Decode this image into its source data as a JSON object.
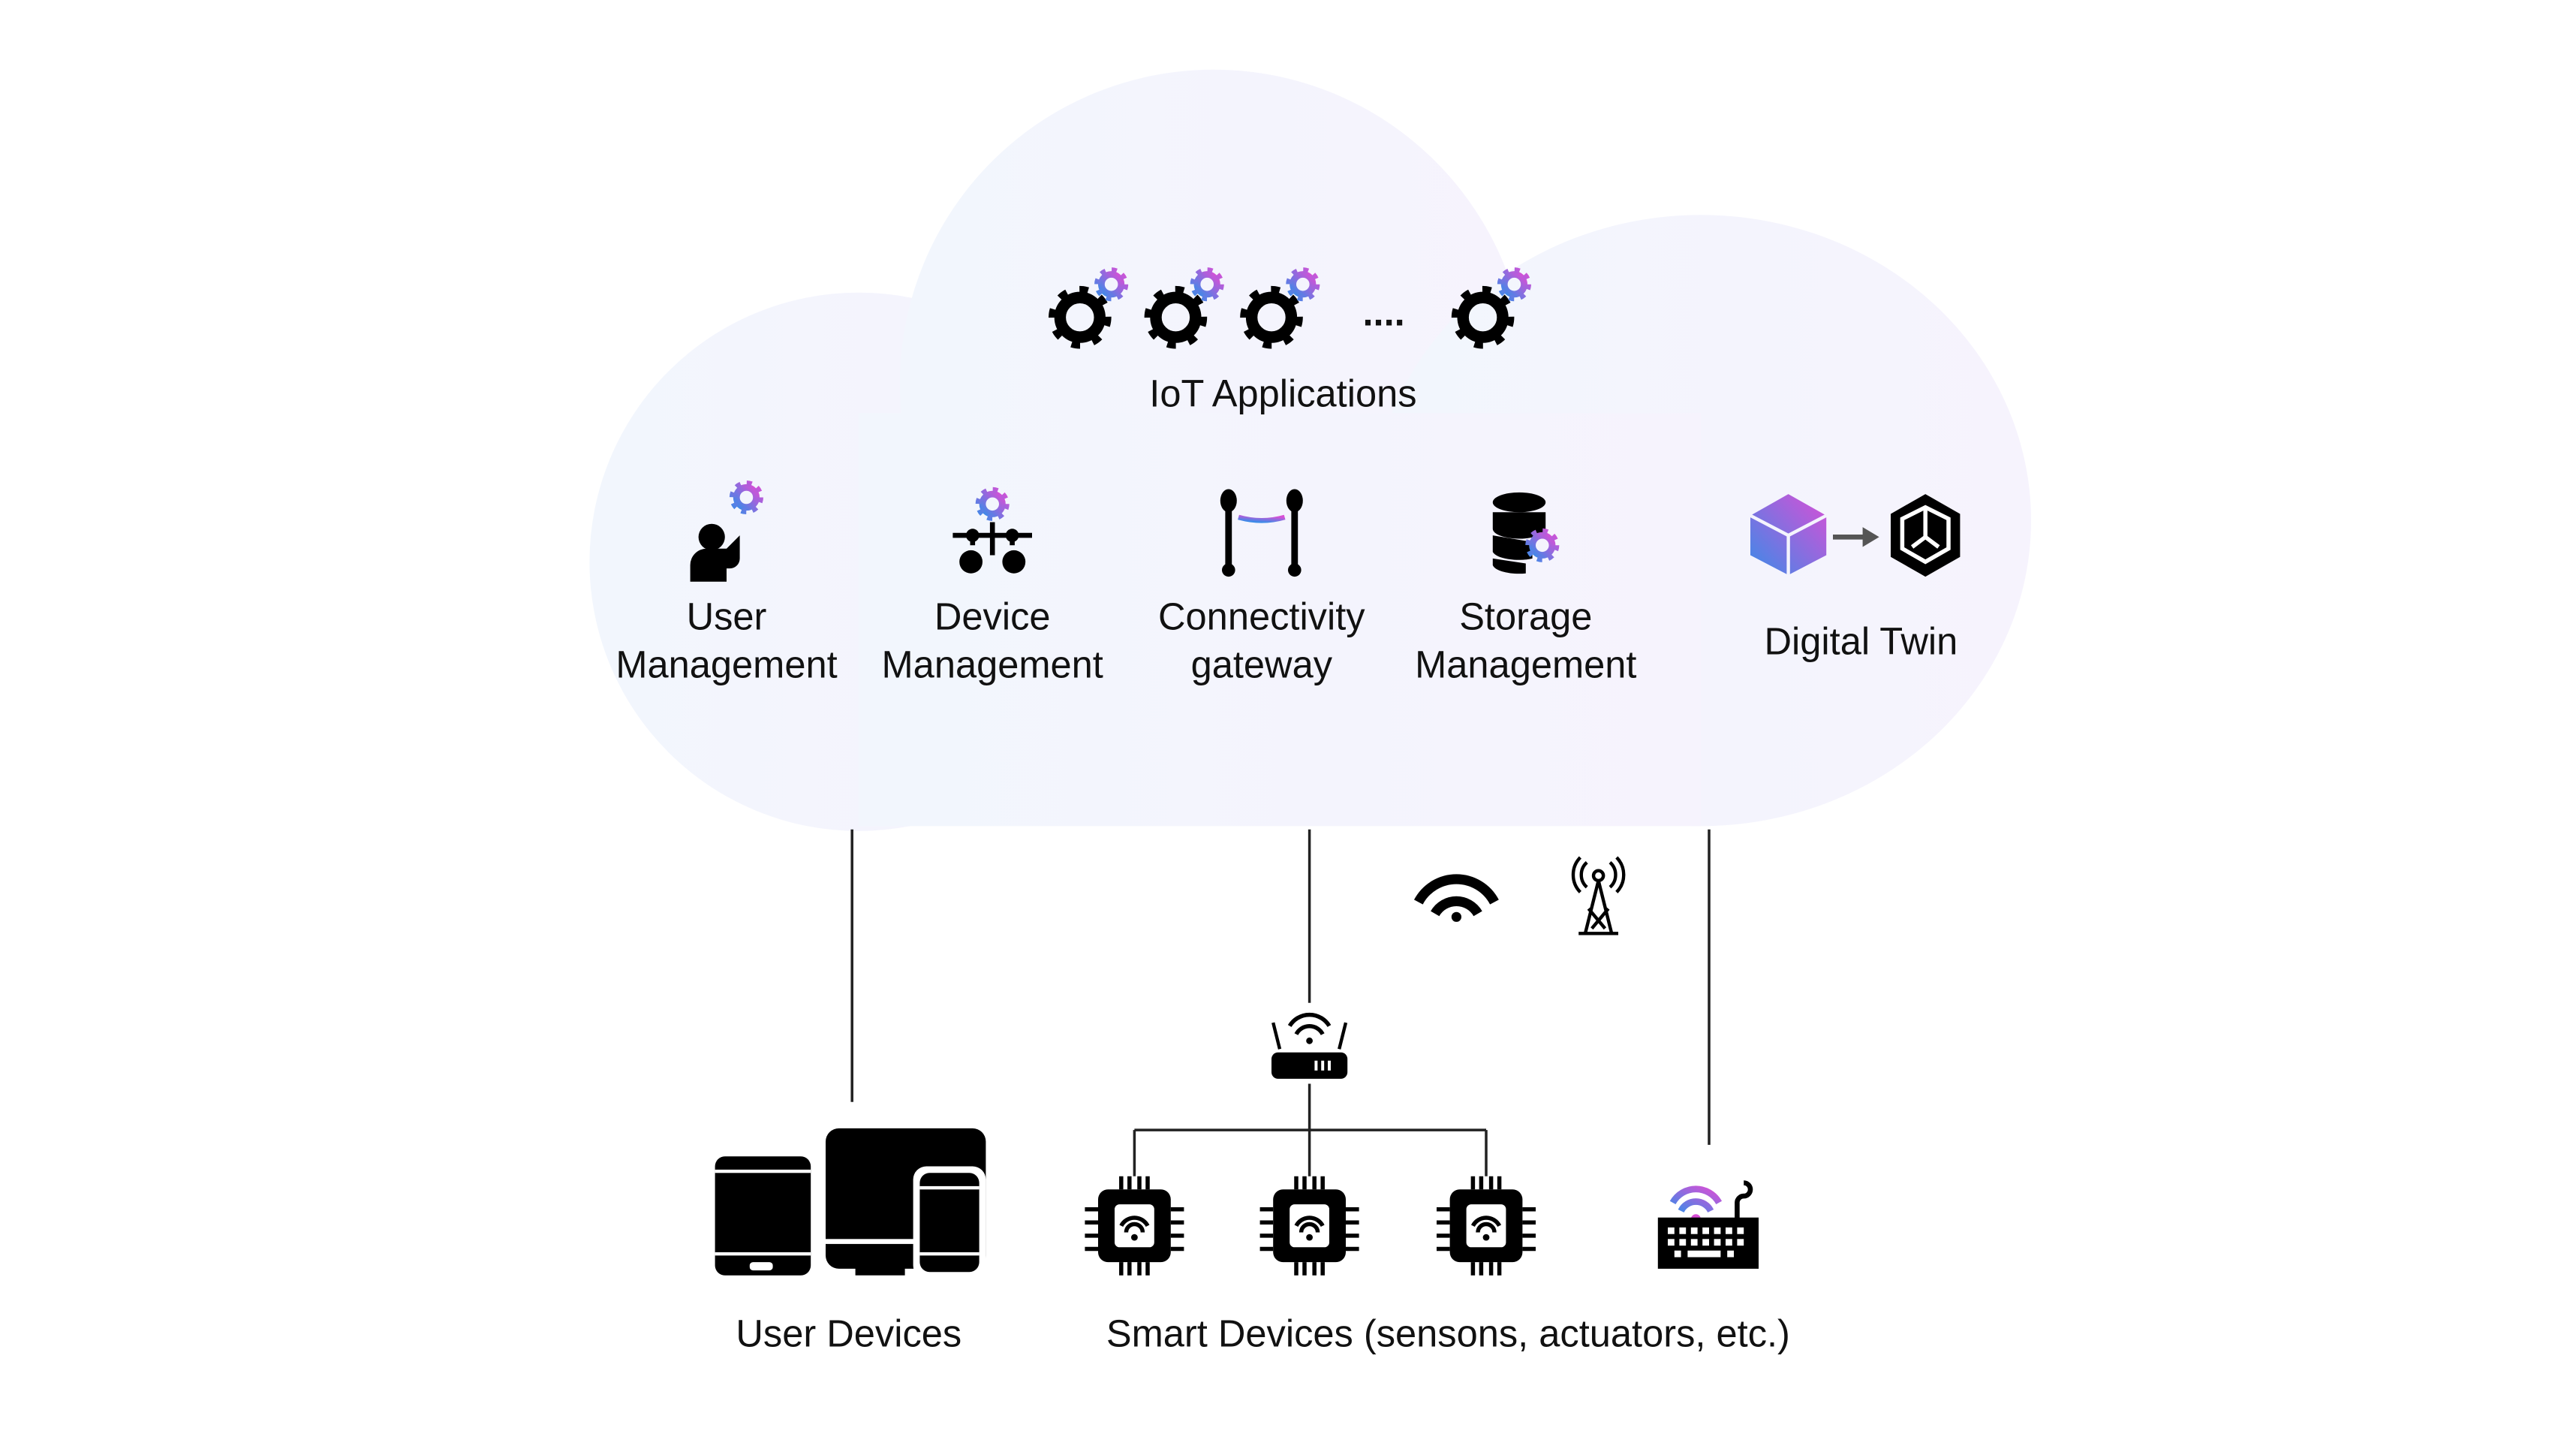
{
  "cloud": {
    "title": "IoT Applications",
    "ellipsis": "....",
    "services": [
      {
        "line1": "User",
        "line2": "Management",
        "icon": "user-gear-icon"
      },
      {
        "line1": "Device",
        "line2": "Management",
        "icon": "device-network-gear-icon"
      },
      {
        "line1": "Connectivity",
        "line2": "gateway",
        "icon": "connectivity-icon"
      },
      {
        "line1": "Storage",
        "line2": "Management",
        "icon": "database-gear-icon"
      },
      {
        "line1": "Digital Twin",
        "icon": "box-to-digital-twin-icon"
      }
    ]
  },
  "network_icons": [
    "wifi-icon",
    "cell-tower-icon",
    "router-icon"
  ],
  "bottom": {
    "user_devices": "User Devices",
    "smart_devices": "Smart Devices (sensons, actuators, etc.)"
  },
  "colors": {
    "cloud_fill_left": "#f2f6fd",
    "cloud_fill_right": "#f6f3fd",
    "accent_gradient_start": "#3b8be8",
    "accent_gradient_end": "#d94fd6",
    "icon": "#000000"
  }
}
